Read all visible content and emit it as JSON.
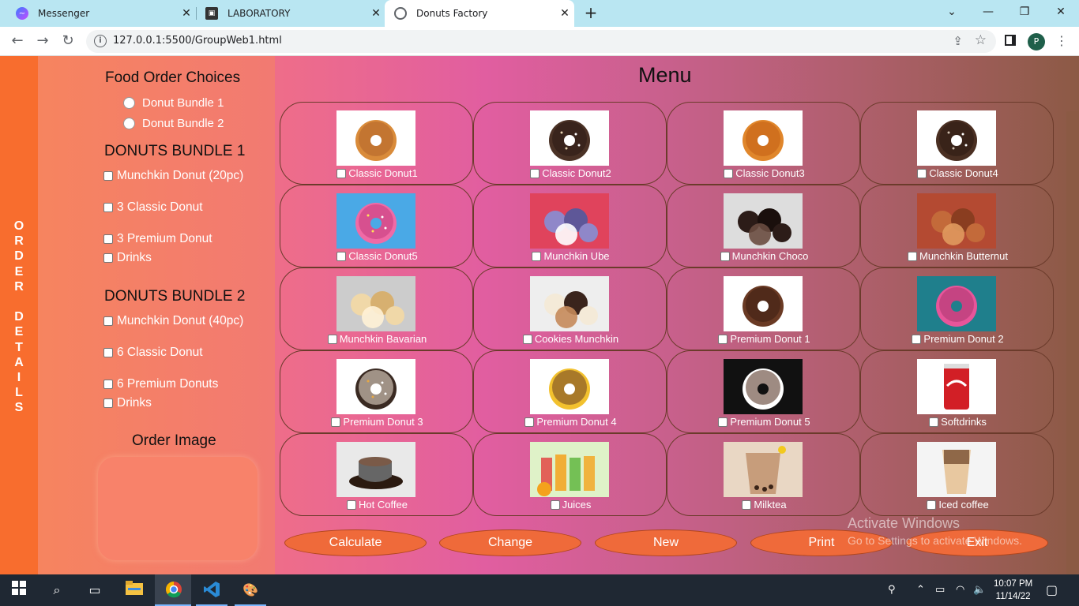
{
  "browser": {
    "tabs": [
      {
        "label": "Messenger",
        "icon": "messenger-icon"
      },
      {
        "label": "LABORATORY",
        "icon": "laboratory-icon"
      },
      {
        "label": "Donuts Factory",
        "icon": "globe-icon",
        "active": true
      }
    ],
    "url": "127.0.0.1:5500/GroupWeb1.html",
    "profile_initial": "P"
  },
  "sidebar": {
    "vertical_text": "ORDER DETAILS"
  },
  "choices": {
    "title": "Food Order Choices",
    "options": [
      "Donut Bundle 1",
      "Donut Bundle 2"
    ]
  },
  "bundle1": {
    "title": "DONUTS BUNDLE 1",
    "items": [
      "Munchkin Donut (20pc)",
      "3 Classic Donut",
      "3 Premium Donut",
      "Drinks"
    ]
  },
  "bundle2": {
    "title": "DONUTS BUNDLE 2",
    "items": [
      "Munchkin Donut (40pc)",
      "6 Classic Donut",
      "6 Premium Donuts",
      "Drinks"
    ]
  },
  "order_image": {
    "label": "Order Image"
  },
  "menu": {
    "title": "Menu",
    "items": [
      "Classic Donut1",
      "Classic Donut2",
      "Classic Donut3",
      "Classic Donut4",
      "Classic Donut5",
      "Munchkin Ube",
      "Munchkin Choco",
      "Munchkin Butternut",
      "Munchkin Bavarian",
      "Cookies Munchkin",
      "Premium Donut 1",
      "Premium Donut 2",
      "Premium Donut 3",
      "Premium Donut 4",
      "Premium Donut 5",
      "Softdrinks",
      "Hot Coffee",
      "Juices",
      "Milktea",
      "Iced coffee"
    ]
  },
  "actions": [
    "Calculate",
    "Change",
    "New",
    "Print",
    "Exit"
  ],
  "watermark": {
    "line1": "Activate Windows",
    "line2": "Go to Settings to activate Windows."
  },
  "taskbar": {
    "time": "10:07 PM",
    "date": "11/14/22"
  },
  "colors": {
    "accent": "#f86d2e",
    "button": "#ef6a3a"
  }
}
